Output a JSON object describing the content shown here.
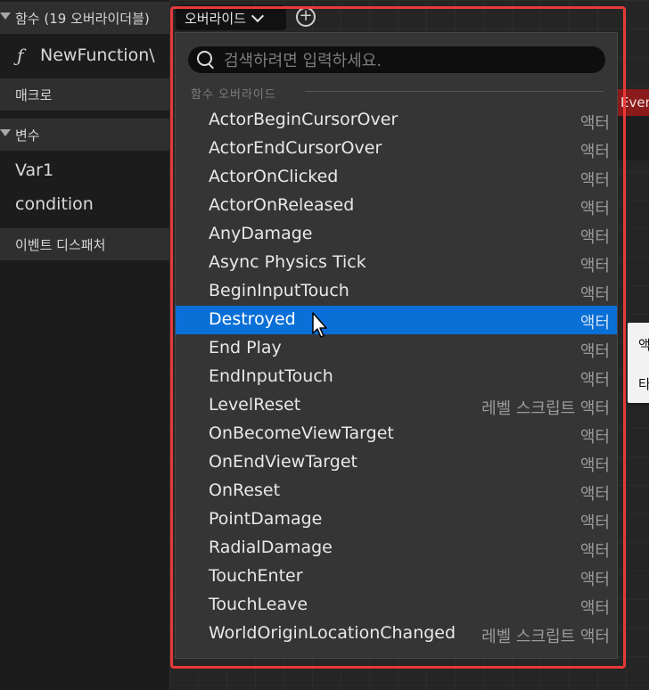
{
  "left_panel": {
    "functions_header": "함수 (19 오버라이더블)",
    "function_item": "NewFunction\\",
    "macros_header": "매크로",
    "variables_header": "변수",
    "variables": [
      "Var1",
      "condition"
    ],
    "dispatchers_header": "이벤트 디스패처"
  },
  "toolbar": {
    "override_label": "오버라이드",
    "add_icon": "plus-circle-icon"
  },
  "graph": {
    "event_node_title": "Event",
    "context_menu_items": [
      "액",
      "타"
    ]
  },
  "popup": {
    "search_placeholder": "검색하려면 입력하세요.",
    "category": "함수 오버라이드",
    "selected_index": 7,
    "items": [
      {
        "name": "ActorBeginCursorOver",
        "category": "액터"
      },
      {
        "name": "ActorEndCursorOver",
        "category": "액터"
      },
      {
        "name": "ActorOnClicked",
        "category": "액터"
      },
      {
        "name": "ActorOnReleased",
        "category": "액터"
      },
      {
        "name": "AnyDamage",
        "category": "액터"
      },
      {
        "name": "Async Physics Tick",
        "category": "액터"
      },
      {
        "name": "BeginInputTouch",
        "category": "액터"
      },
      {
        "name": "Destroyed",
        "category": "액터"
      },
      {
        "name": "End Play",
        "category": "액터"
      },
      {
        "name": "EndInputTouch",
        "category": "액터"
      },
      {
        "name": "LevelReset",
        "category": "레벨 스크립트 액터"
      },
      {
        "name": "OnBecomeViewTarget",
        "category": "액터"
      },
      {
        "name": "OnEndViewTarget",
        "category": "액터"
      },
      {
        "name": "OnReset",
        "category": "액터"
      },
      {
        "name": "PointDamage",
        "category": "액터"
      },
      {
        "name": "RadialDamage",
        "category": "액터"
      },
      {
        "name": "TouchEnter",
        "category": "액터"
      },
      {
        "name": "TouchLeave",
        "category": "액터"
      },
      {
        "name": "WorldOriginLocationChanged",
        "category": "레벨 스크립트 액터"
      }
    ]
  },
  "colors": {
    "highlight": "#e8393a",
    "selection": "#0a6fd6"
  }
}
